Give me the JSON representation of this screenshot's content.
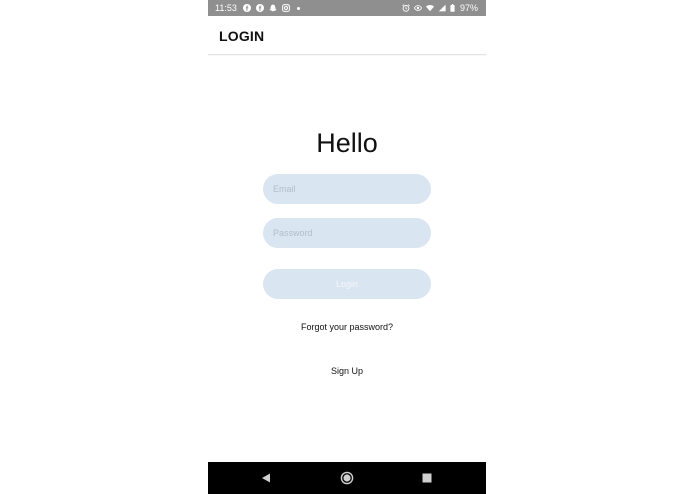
{
  "status_bar": {
    "time": "11:53",
    "left_icons": [
      "facebook-icon",
      "facebook-icon",
      "snapchat-icon",
      "instagram-icon",
      "notification-dot-icon"
    ],
    "right_icons": [
      "alarm-icon",
      "eye-icon",
      "wifi-icon",
      "signal-icon",
      "battery-icon"
    ],
    "battery": "97%"
  },
  "app_bar": {
    "title": "LOGIN"
  },
  "login_form": {
    "heading": "Hello",
    "email_placeholder": "Email",
    "email_value": "",
    "password_placeholder": "Password",
    "password_value": "",
    "login_label": "Login",
    "forgot_label": "Forgot your password?",
    "signup_label": "Sign Up"
  },
  "nav_bar": {
    "icons": [
      "back-icon",
      "home-icon",
      "recents-icon"
    ]
  },
  "colors": {
    "status_bar_bg": "#8f8f8f",
    "field_bg": "#d9e5f1",
    "nav_bar_bg": "#000000"
  }
}
